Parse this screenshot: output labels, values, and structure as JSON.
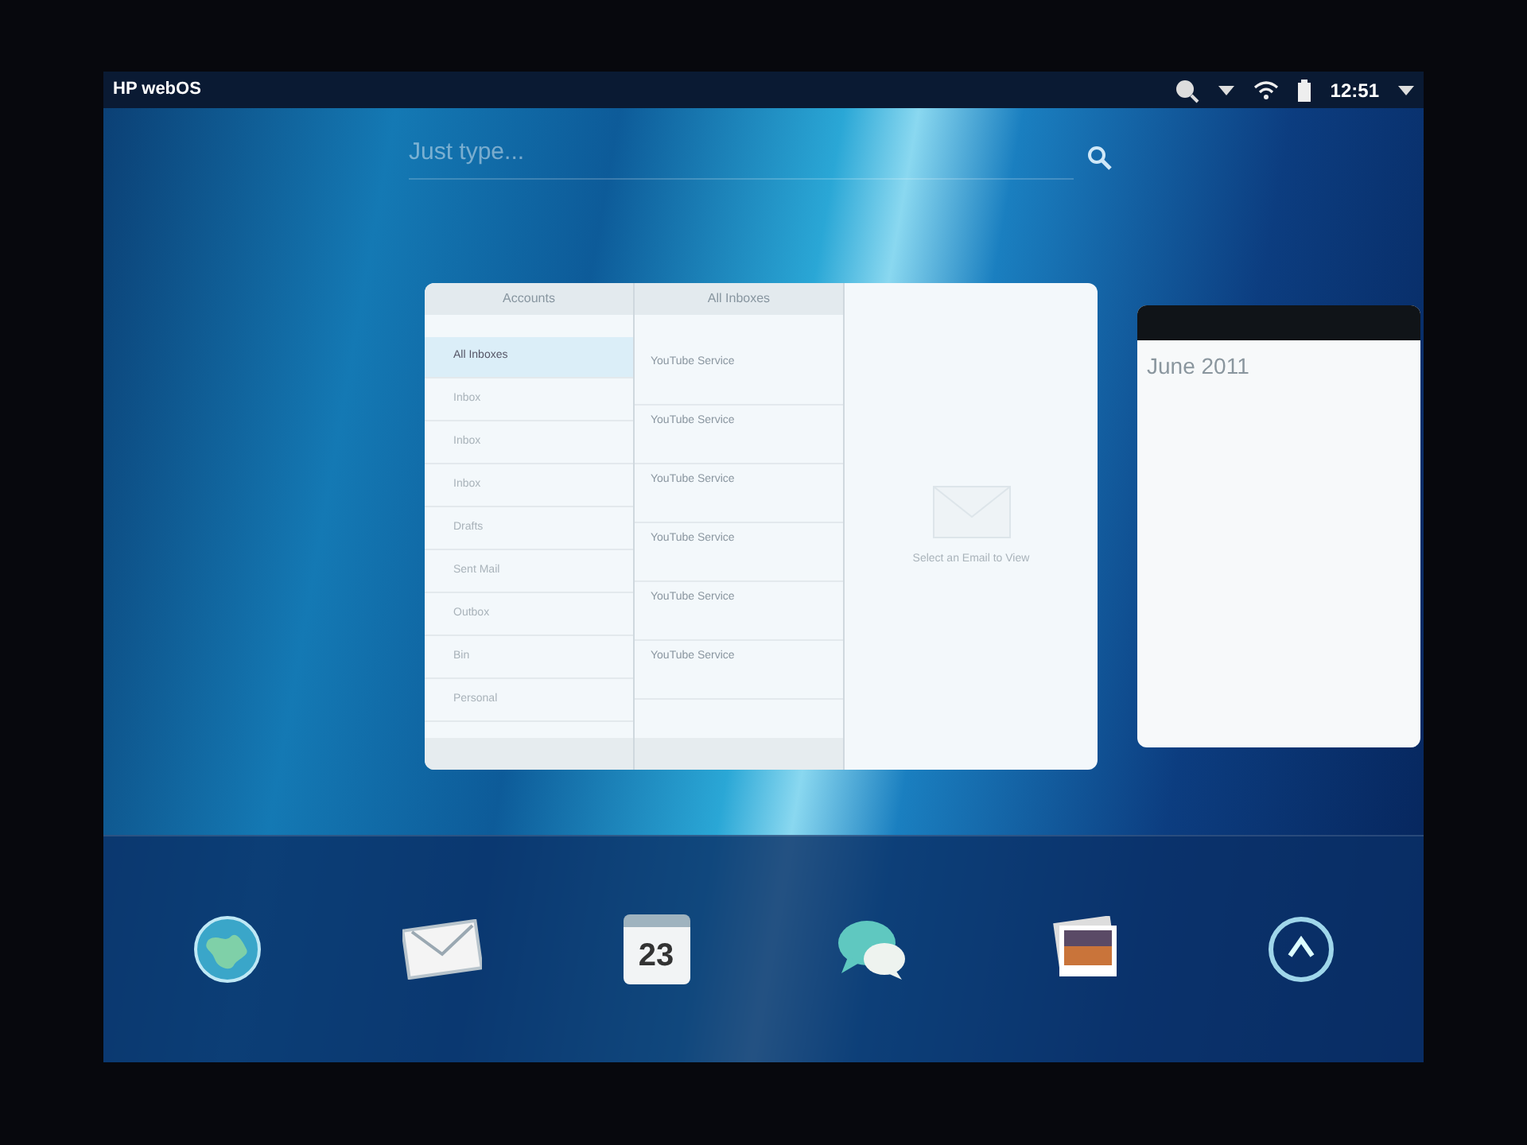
{
  "status_bar": {
    "title": "HP webOS",
    "time": "12:51"
  },
  "search": {
    "placeholder": "Just type..."
  },
  "email_card": {
    "accounts_title": "Accounts",
    "list_title": "All Inboxes",
    "empty_text": "Select an Email to View",
    "folders": [
      {
        "label": "All Inboxes",
        "selected": true
      },
      {
        "label": "Inbox",
        "selected": false
      },
      {
        "label": "Inbox",
        "selected": false
      },
      {
        "label": "Inbox",
        "selected": false
      },
      {
        "label": "Drafts",
        "selected": false
      },
      {
        "label": "Sent Mail",
        "selected": false
      },
      {
        "label": "Outbox",
        "selected": false
      },
      {
        "label": "Bin",
        "selected": false
      },
      {
        "label": "Personal",
        "selected": false
      }
    ],
    "messages": [
      {
        "sender": "YouTube Service"
      },
      {
        "sender": "YouTube Service"
      },
      {
        "sender": "YouTube Service"
      },
      {
        "sender": "YouTube Service"
      },
      {
        "sender": "YouTube Service"
      },
      {
        "sender": "YouTube Service"
      }
    ]
  },
  "calendar_card": {
    "title": "June 2011"
  },
  "dock": [
    {
      "kind": "globe"
    },
    {
      "kind": "mail"
    },
    {
      "kind": "calendar",
      "day": "23"
    },
    {
      "kind": "chat"
    },
    {
      "kind": "photos"
    },
    {
      "kind": "launcher"
    }
  ]
}
